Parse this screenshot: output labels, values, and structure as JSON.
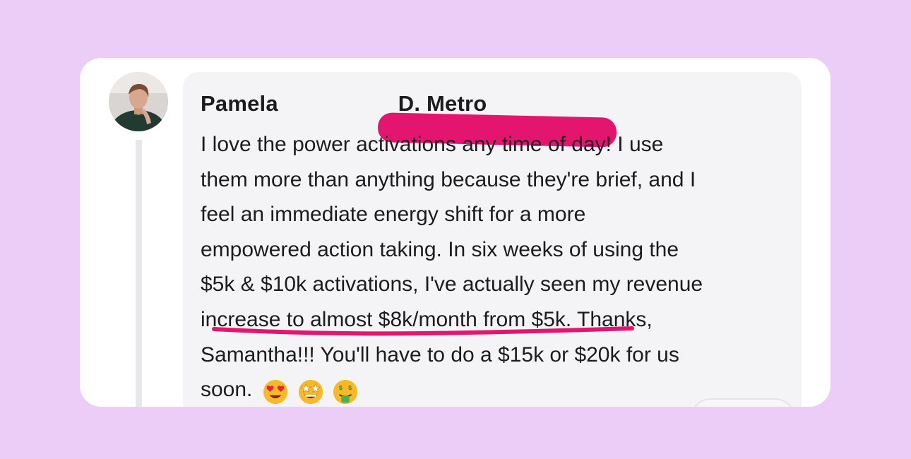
{
  "comment": {
    "author": "Pamela",
    "author_hidden_fragment": "D. Metro",
    "lines": [
      "I love the power activations any time of day! I use",
      "them more than anything because they're brief, and I",
      "feel an immediate energy shift for a more",
      "empowered action taking. In six weeks of using the",
      "$5k & $10k activations, I've actually seen my revenue",
      "increase to almost $8k/month from $5k. Thanks,",
      "Samantha!!! You'll have to do a $15k or $20k for us",
      "soon."
    ],
    "emojis": [
      "heart-eyes-emoji",
      "star-struck-emoji",
      "money-mouth-emoji"
    ]
  },
  "colors": {
    "background": "#ebcdf8",
    "card": "#ffffff",
    "bubble": "#f4f4f6",
    "marker": "#e3156f",
    "text": "#1c1c1e"
  }
}
